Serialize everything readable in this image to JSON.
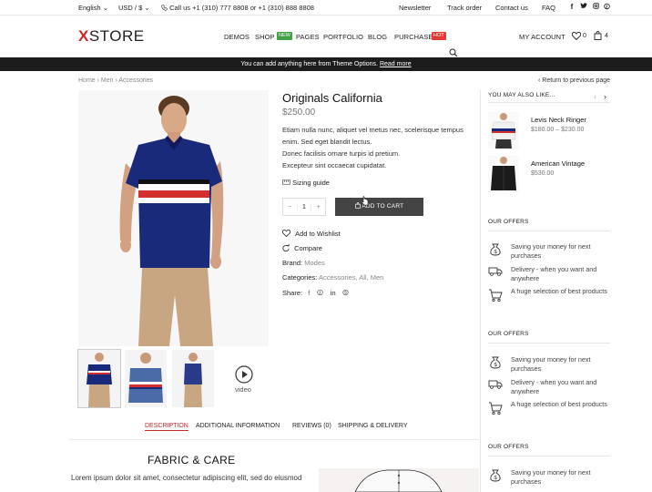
{
  "topbar": {
    "language": "English",
    "currency": "USD / $",
    "phone": "Call us +1 (310) 777 8808 or +1 (310) 888 8808",
    "links": [
      "Newsletter",
      "Track order",
      "Contact us",
      "FAQ"
    ],
    "social_icons": [
      "facebook-icon",
      "twitter-icon",
      "instagram-icon",
      "pinterest-icon"
    ]
  },
  "header": {
    "logo_x": "X",
    "logo_rest": "STORE",
    "nav": [
      "DEMOS",
      "SHOP",
      "PAGES",
      "PORTFOLIO",
      "BLOG",
      "PURCHASE"
    ],
    "badge_new": "NEW",
    "badge_hot": "HOT",
    "account": "MY ACCOUNT",
    "wishlist_count": "0",
    "cart_count": "4"
  },
  "notice": {
    "text": "You can add anything here from Theme Options.",
    "link": "Read more"
  },
  "breadcrumb": {
    "items": [
      "Home",
      "Men",
      "Accessories"
    ],
    "return": "Return to previous page"
  },
  "product": {
    "title": "Originals California",
    "price": "$250.00",
    "desc_1": "Etiam nulla nunc, aliquet vel metus nec, scelerisque tempus enim. Sed eget blandit lectus.",
    "desc_2": "Donec facilisis ornare turpis id pretium.",
    "desc_3": "Excepteur sint occaecat cupidatat.",
    "sizing": "Sizing guide",
    "qty": "1",
    "minus": "−",
    "plus": "+",
    "add_to_cart": "ADD TO CART",
    "wishlist": "Add to Wishlist",
    "compare": "Compare",
    "brand_label": "Brand:",
    "brand": "Modes",
    "categories_label": "Categories:",
    "categories": "Accessories, All, Men",
    "share_label": "Share:",
    "video_label": "video"
  },
  "tabs": [
    "DESCRIPTION",
    "ADDITIONAL INFORMATION",
    "REVIEWS (0)",
    "SHIPPING & DELIVERY"
  ],
  "description": {
    "heading": "FABRIC & CARE",
    "text": "Lorem ipsum dolor sit amet, consectetur adipiscing elit, sed do eiusmod"
  },
  "sidebar": {
    "also_like": "YOU MAY ALSO LIKE...",
    "products": [
      {
        "name": "Levis Neck Ringer",
        "price": "$180.00 – $230.00"
      },
      {
        "name": "American Vintage",
        "price": "$530.00"
      }
    ],
    "offers_heading": "OUR OFFERS",
    "offers": [
      "Saving your money for next purchases",
      "Delivery - when you want and anywhere",
      "A huge selection of best products"
    ]
  },
  "colors": {
    "accent": "#c62828",
    "notice_bg": "#1c1c1c",
    "cart_button": "#444444",
    "shirt_blue": "#1a2a7a"
  }
}
